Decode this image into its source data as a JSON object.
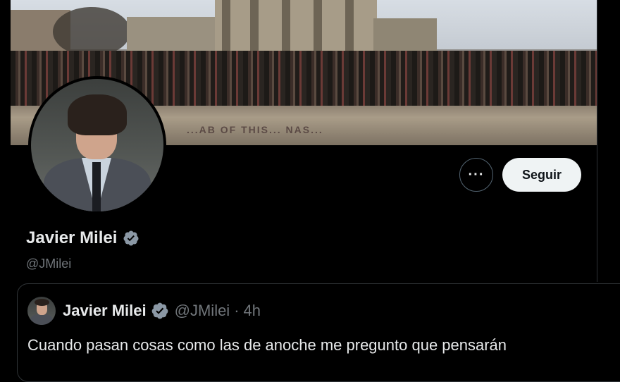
{
  "profile": {
    "display_name": "Javier Milei",
    "handle": "@JMilei",
    "follow_label": "Seguir",
    "more_label": "···",
    "verified_icon": "verified-badge-icon",
    "banner_graffiti": "...AB OF THIS... NAS..."
  },
  "quoted_post": {
    "author_name": "Javier Milei",
    "author_handle": "@JMilei",
    "separator": "·",
    "time": "4h",
    "text": "Cuando pasan cosas como las de anoche me pregunto que pensarán"
  },
  "colors": {
    "background": "#000000",
    "text_primary": "#e7e9ea",
    "text_secondary": "#71767b",
    "verified": "#8b98a5",
    "follow_button_bg": "#eff3f4",
    "border": "#2f3336"
  }
}
